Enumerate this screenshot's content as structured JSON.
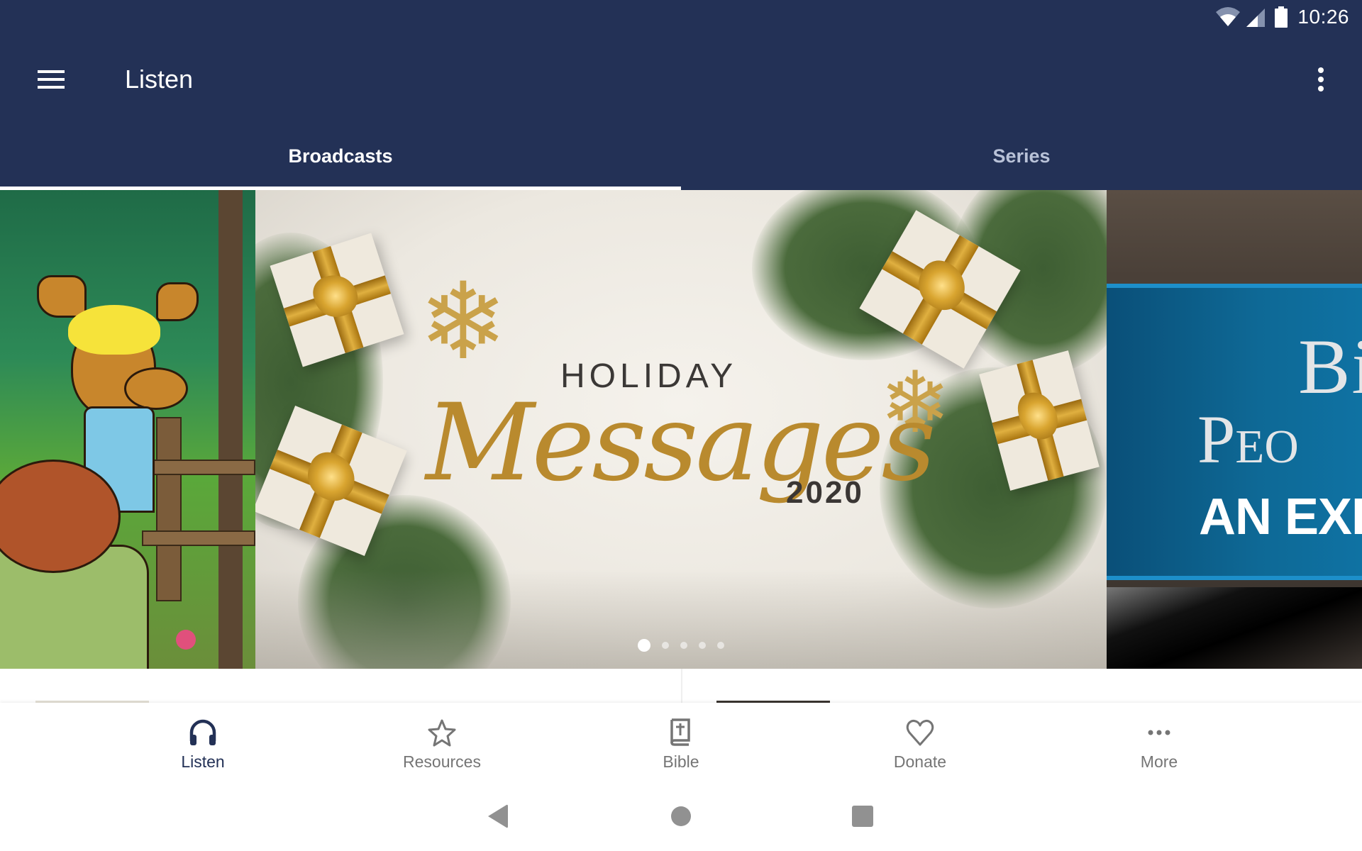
{
  "status_bar": {
    "time": "10:26",
    "icons": [
      "wifi-icon",
      "cell-signal-icon",
      "battery-icon"
    ]
  },
  "app_bar": {
    "title": "Listen",
    "menu_icon": "hamburger-menu-icon",
    "overflow_icon": "more-vert-icon"
  },
  "tabs": [
    {
      "label": "Broadcasts",
      "active": true
    },
    {
      "label": "Series",
      "active": false
    }
  ],
  "carousel": {
    "slides": [
      {
        "name": "cartoon-moose-beaver-slide",
        "visible": "partial"
      },
      {
        "name": "holiday-messages-2020-slide",
        "title_top": "HOLIDAY",
        "title_script": "Messages",
        "year": "2020"
      },
      {
        "name": "bible-people-slide",
        "line1": "Bi",
        "line2": "Peo",
        "line3": "AN EXP"
      }
    ],
    "page_count": 5,
    "current_page": 1
  },
  "bottom_nav": {
    "items": [
      {
        "label": "Listen",
        "icon": "headphones-icon",
        "active": true
      },
      {
        "label": "Resources",
        "icon": "star-icon",
        "active": false
      },
      {
        "label": "Bible",
        "icon": "bible-icon",
        "active": false
      },
      {
        "label": "Donate",
        "icon": "heart-icon",
        "active": false
      },
      {
        "label": "More",
        "icon": "more-horiz-icon",
        "active": false
      }
    ]
  },
  "system_nav": {
    "buttons": [
      "back",
      "home",
      "recents"
    ]
  },
  "colors": {
    "primary": "#233156",
    "tab_inactive": "#b9c2d8",
    "nav_inactive": "#757575",
    "indicator": "#ffffff"
  }
}
